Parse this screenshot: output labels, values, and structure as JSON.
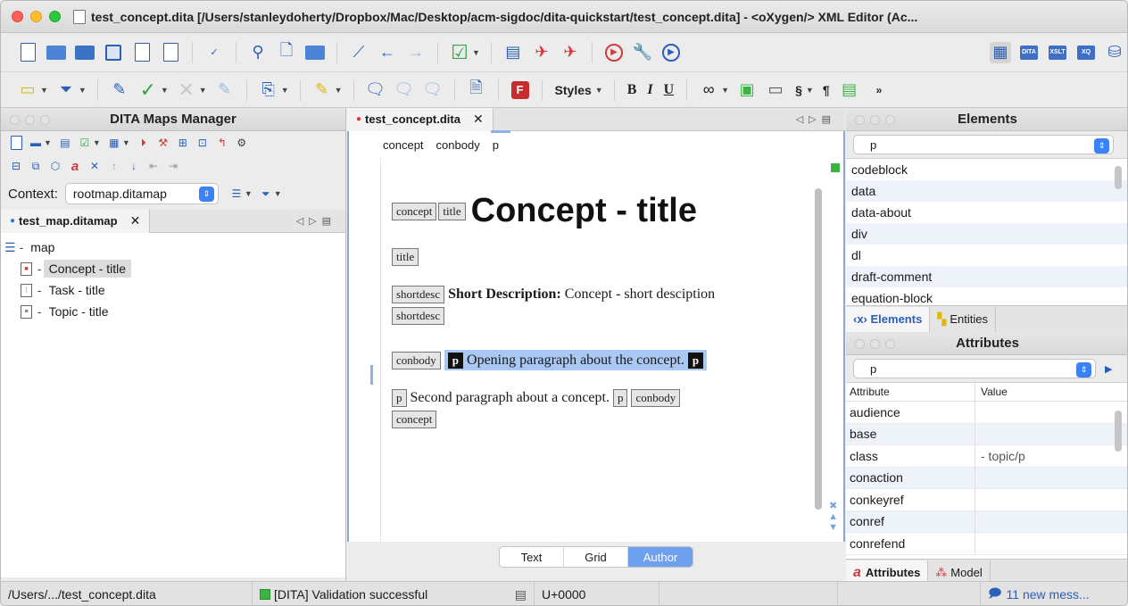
{
  "window": {
    "title": "test_concept.dita [/Users/stanleydoherty/Dropbox/Mac/Desktop/acm-sigdoc/dita-quickstart/test_concept.dita] - <oXygen/> XML Editor (Ac..."
  },
  "toolbar2": {
    "styles_label": "Styles",
    "bold": "B",
    "italic": "I",
    "underline": "U",
    "section": "§",
    "pilcrow": "¶"
  },
  "maps_manager": {
    "title": "DITA Maps Manager",
    "context_label": "Context:",
    "context_value": "rootmap.ditamap",
    "tab_label": "test_map.ditamap",
    "tree": {
      "root": "map",
      "items": [
        {
          "label": "Concept - title",
          "selected": true
        },
        {
          "label": "Task - title",
          "selected": false
        },
        {
          "label": "Topic - title",
          "selected": false
        }
      ]
    }
  },
  "editor": {
    "tab_label": "test_concept.dita",
    "breadcrumb": [
      "concept",
      "conbody",
      "p"
    ],
    "tags": {
      "concept": "concept",
      "title": "title",
      "shortdesc": "shortdesc",
      "conbody": "conbody",
      "p": "p"
    },
    "heading": "Concept - title",
    "shortdesc_bold": "Short Description:",
    "shortdesc_text": "Concept - short desciption",
    "para1": "Opening paragraph about the concept.",
    "para2": "Second paragraph about a concept.",
    "modes": [
      "Text",
      "Grid",
      "Author"
    ],
    "active_mode": "Author"
  },
  "elements_panel": {
    "title": "Elements",
    "filter": "p",
    "items": [
      "codeblock",
      "data",
      "data-about",
      "div",
      "dl",
      "draft-comment",
      "equation-block"
    ],
    "tabs": [
      "‹x› Elements",
      "Entities"
    ]
  },
  "attributes_panel": {
    "title": "Attributes",
    "element": "p",
    "columns": [
      "Attribute",
      "Value"
    ],
    "rows": [
      {
        "name": "audience",
        "value": ""
      },
      {
        "name": "base",
        "value": ""
      },
      {
        "name": "class",
        "value": "- topic/p"
      },
      {
        "name": "conaction",
        "value": ""
      },
      {
        "name": "conkeyref",
        "value": ""
      },
      {
        "name": "conref",
        "value": ""
      },
      {
        "name": "conrefend",
        "value": ""
      }
    ],
    "tabs": [
      "Attributes",
      "Model"
    ]
  },
  "status_bar": {
    "path": "/Users/.../test_concept.dita",
    "validation": "[DITA] Validation successful",
    "unicode": "U+0000",
    "messages": "11 new mess..."
  },
  "colors": {
    "accent": "#3a82f7",
    "selection": "#a9c8f4",
    "valid_green": "#3bb542"
  }
}
